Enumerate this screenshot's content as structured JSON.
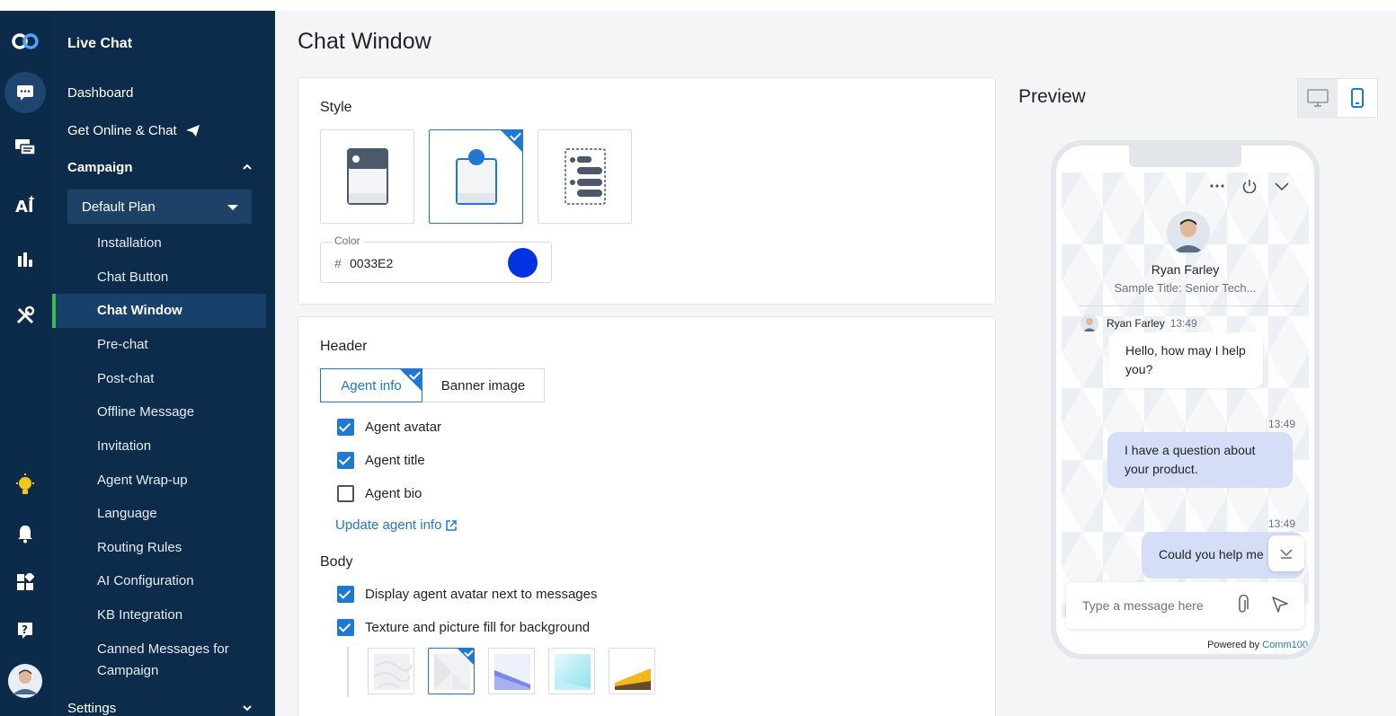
{
  "app": {
    "section": "Live Chat"
  },
  "rail": {
    "icons": [
      "comm100-logo-icon",
      "chat-bubble-icon",
      "messages-icon",
      "ai-icon",
      "bar-chart-icon",
      "tools-icon",
      "lightbulb-icon",
      "bell-icon",
      "apps-icon",
      "help-icon",
      "user-avatar"
    ]
  },
  "nav": {
    "dashboard": "Dashboard",
    "get_online": "Get Online & Chat",
    "campaign": "Campaign",
    "plan": "Default Plan",
    "sub_items": [
      "Installation",
      "Chat Button",
      "Chat Window",
      "Pre-chat",
      "Post-chat",
      "Offline Message",
      "Invitation",
      "Agent Wrap-up",
      "Language",
      "Routing Rules",
      "AI Configuration",
      "KB Integration",
      "Canned Messages for",
      "Campaign"
    ],
    "settings": "Settings"
  },
  "page": {
    "title": "Chat Window"
  },
  "style_section": {
    "label": "Style",
    "options": [
      "classic-style",
      "bubble-style",
      "sidebar-style"
    ],
    "selected": 1,
    "color_label": "Color",
    "color_hash": "#",
    "color_value": "0033E2",
    "color_hex": "#0033E2"
  },
  "header_section": {
    "label": "Header",
    "tabs": [
      "Agent info",
      "Banner image"
    ],
    "selected_tab": 0,
    "checkboxes": [
      {
        "label": "Agent avatar",
        "checked": true
      },
      {
        "label": "Agent title",
        "checked": true
      },
      {
        "label": "Agent bio",
        "checked": false
      }
    ],
    "link": "Update agent info"
  },
  "body_section": {
    "label": "Body",
    "checkboxes": [
      {
        "label": "Display agent avatar next to messages",
        "checked": true
      },
      {
        "label": "Texture and picture fill for background",
        "checked": true
      }
    ],
    "textures_selected": 1
  },
  "preview": {
    "title": "Preview",
    "device_selected": "mobile",
    "agent_name": "Ryan Farley",
    "agent_title": "Sample Title: Senior Tech...",
    "message_author": "Ryan Farley",
    "message_time": "13:49",
    "agent_message": "Hello, how may I help you?",
    "visitor_time_1": "13:49",
    "visitor_message_1": "I have a question about your product.",
    "visitor_time_2": "13:49",
    "visitor_message_2": "Could you help me",
    "input_placeholder": "Type a message here",
    "powered_by": "Powered by",
    "brand": "Comm100"
  },
  "colors": {
    "sidebar": "#0d2b4a",
    "accent": "#1f78d1",
    "active_indicator": "#3fb950",
    "visitor_bubble": "#d6ddf7"
  }
}
